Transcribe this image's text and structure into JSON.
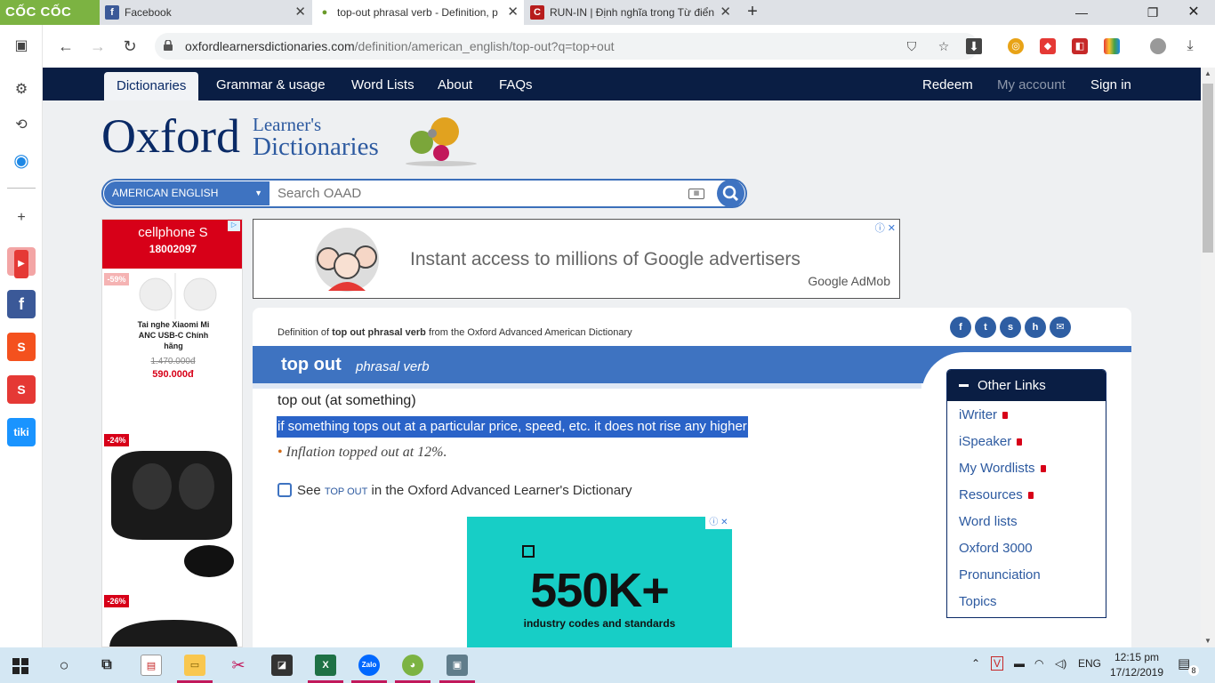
{
  "browser": {
    "logo_text": "CỐC CỐC",
    "tabs": [
      {
        "title": "Facebook",
        "icon": "facebook-icon",
        "active": false
      },
      {
        "title": "top-out phrasal verb - Definition, p",
        "icon": "oxford-icon",
        "active": true
      },
      {
        "title": "RUN-IN | Định nghĩa trong Từ điển",
        "icon": "cambridge-icon",
        "active": false
      }
    ],
    "url_domain": "oxfordlearnersdictionaries.com",
    "url_path": "/definition/american_english/top-out?q=top+out"
  },
  "site_nav": {
    "left": [
      "Dictionaries",
      "Grammar & usage",
      "Word Lists",
      "About",
      "FAQs"
    ],
    "right": [
      "Redeem",
      "My account",
      "Sign in"
    ]
  },
  "logo": {
    "oxford": "Oxford",
    "learners": "Learner's",
    "dictionaries": "Dictionaries"
  },
  "search": {
    "dictionary": "AMERICAN ENGLISH",
    "placeholder": "Search OAAD"
  },
  "left_ad": {
    "brand": "cellphone S",
    "phone": "18002097",
    "items": [
      {
        "discount": "-59%",
        "name": "Tai nghe Xiaomi Mi ANC USB-C Chính hãng",
        "old_price": "1.470.000đ",
        "new_price": "590.000đ"
      },
      {
        "discount": "-24%"
      },
      {
        "discount": "-26%"
      }
    ]
  },
  "top_ad": {
    "text": "Instant access to millions of Google advertisers",
    "brand_google": "Google",
    "brand_admob": " AdMob"
  },
  "entry": {
    "source_prefix": "Definition of ",
    "source_term": "top out phrasal verb",
    "source_suffix": " from the Oxford Advanced American Dictionary",
    "headword": "top out",
    "pos": "phrasal verb",
    "phrasal": "top out (at something)",
    "definition": "if something tops out at a particular price, speed, etc. it does not rise any higher",
    "example": "Inflation topped out at 12%.",
    "see_prefix": "See ",
    "see_term": "TOP OUT",
    "see_suffix": " in the Oxford Advanced Learner's Dictionary"
  },
  "bottom_ad": {
    "number": "550K+",
    "subtitle": "industry codes and standards"
  },
  "other_links": {
    "title": "Other Links",
    "items": [
      {
        "label": "iWriter",
        "locked": true
      },
      {
        "label": "iSpeaker",
        "locked": true
      },
      {
        "label": "My Wordlists",
        "locked": true
      },
      {
        "label": "Resources",
        "locked": true
      },
      {
        "label": "Word lists",
        "locked": false
      },
      {
        "label": "Oxford 3000",
        "locked": false
      },
      {
        "label": "Pronunciation",
        "locked": false
      },
      {
        "label": "Topics",
        "locked": false
      }
    ]
  },
  "taskbar": {
    "language": "ENG",
    "time": "12:15 pm",
    "date": "17/12/2019",
    "notifications": "8"
  },
  "colors": {
    "navy": "#0a1e44",
    "blue": "#3e73c1",
    "highlight": "#2a63c8",
    "coccoc_green": "#7cb342"
  }
}
